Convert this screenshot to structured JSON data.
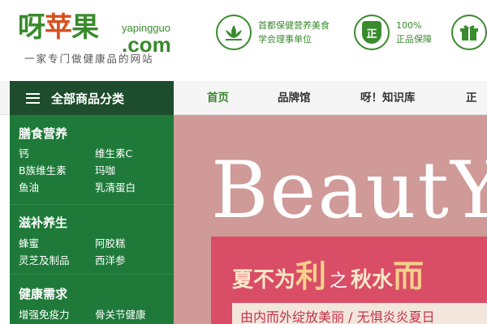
{
  "header": {
    "logo_cn_a": "呀",
    "logo_cn_b": "苹",
    "logo_cn_c": "果",
    "logo_en_top": "yapingguo",
    "logo_en": ".com",
    "tagline": "一家专门做健康品的网站",
    "badges": [
      {
        "line1": "首都保健营养美食",
        "line2": "学会理事单位",
        "icon": "lotus-icon"
      },
      {
        "line1": "100%",
        "line2": "正品保障",
        "icon": "shield-icon",
        "icon_text": "正"
      },
      {
        "icon": "gift-icon"
      }
    ]
  },
  "nav": {
    "category_label": "全部商品分类",
    "items": [
      "首页",
      "品牌馆",
      "呀！知识库",
      "正品"
    ]
  },
  "sidebar": {
    "groups": [
      {
        "title": "膳食营养",
        "links": [
          "钙",
          "维生素C",
          "B族维生素",
          "玛咖",
          "鱼油",
          "乳清蛋白"
        ]
      },
      {
        "title": "滋补养生",
        "links": [
          "蜂蜜",
          "阿胶糕",
          "灵芝及制品",
          "西洋参"
        ]
      },
      {
        "title": "健康需求",
        "links": [
          "增强免疫力",
          "骨关节健康"
        ]
      }
    ]
  },
  "banner": {
    "headline": "BeautY",
    "slogan_a": "夏不为",
    "slogan_b": "利",
    "slogan_c": "之",
    "slogan_d": "秋水",
    "slogan_e": "而",
    "subline": "由内而外绽放美丽 / 无惧炎炎夏日"
  },
  "colors": {
    "brand_green": "#3a8a2e",
    "sidebar_green": "#1f7a3a",
    "nav_dark": "#1d4d2c",
    "banner_pink": "#cf9a98"
  }
}
